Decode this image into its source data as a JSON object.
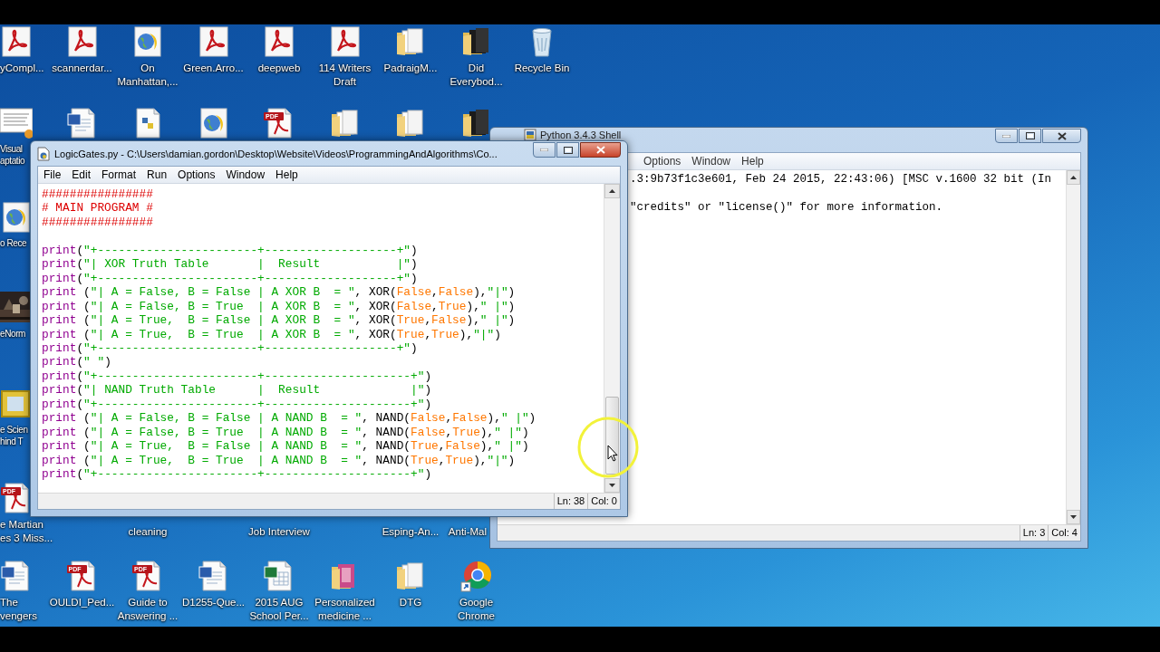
{
  "desktop_icons": [
    {
      "kind": "pdf",
      "lines": [
        "yCompl..."
      ]
    },
    {
      "kind": "pdf",
      "lines": [
        "scannerdar..."
      ]
    },
    {
      "kind": "globe",
      "lines": [
        "On",
        "Manhattan,..."
      ]
    },
    {
      "kind": "pdf",
      "lines": [
        "Green.Arro..."
      ]
    },
    {
      "kind": "pdf",
      "lines": [
        "deepweb"
      ]
    },
    {
      "kind": "pdf",
      "lines": [
        "114 Writers",
        "Draft"
      ]
    },
    {
      "kind": "folder",
      "lines": [
        "PadraigM..."
      ]
    },
    {
      "kind": "folder-dark",
      "lines": [
        "Did",
        "Everybod..."
      ]
    },
    {
      "kind": "recycle",
      "lines": [
        "Recycle Bin"
      ]
    },
    {
      "kind": "document",
      "lines": [
        "Visual",
        "aptatio"
      ]
    },
    {
      "kind": "word"
    },
    {
      "kind": "python"
    },
    {
      "kind": "globe"
    },
    {
      "kind": "pdf-badge",
      "badge": "PDF"
    },
    {
      "kind": "folder"
    },
    {
      "kind": "folder"
    },
    {
      "kind": "folder-dark"
    },
    {
      "kind": "globe",
      "lines": [
        "o Rece"
      ]
    },
    {
      "kind": "video",
      "lines": [
        "eNorm"
      ]
    },
    {
      "kind": "frame",
      "lines": [
        "e Scien",
        "hind T"
      ]
    },
    {
      "kind": "pdf-badge",
      "badge": "PDF",
      "lines": [
        "e Martian",
        "es 3 Miss..."
      ]
    },
    {
      "kind": "covered",
      "lines": [
        "cleaning"
      ]
    },
    {
      "kind": "covered",
      "lines": [
        "Job Interview"
      ]
    },
    {
      "kind": "covered",
      "lines": [
        "Esping-An..."
      ]
    },
    {
      "kind": "covered",
      "lines": [
        "Anti-Mal"
      ]
    },
    {
      "kind": "word",
      "lines": [
        "The",
        "vengers"
      ]
    },
    {
      "kind": "pdf-badge",
      "badge": "PDF",
      "lines": [
        "OULDI_Ped..."
      ]
    },
    {
      "kind": "pdf-badge",
      "badge": "PDF",
      "lines": [
        "Guide to",
        "Answering ..."
      ]
    },
    {
      "kind": "word",
      "lines": [
        "D1255-Que..."
      ]
    },
    {
      "kind": "excel",
      "lines": [
        "2015 AUG",
        "School Per..."
      ]
    },
    {
      "kind": "folder-photos",
      "lines": [
        "Personalized",
        "medicine ..."
      ]
    },
    {
      "kind": "folder",
      "lines": [
        "DTG"
      ]
    },
    {
      "kind": "chrome",
      "lines": [
        "Google",
        "Chrome"
      ]
    }
  ],
  "shell": {
    "title": "Python 3.4.3 Shell",
    "menu": [
      "Options",
      "Window",
      "Help"
    ],
    "lines": [
      ".3:9b73f1c3e601, Feb 24 2015, 22:43:06) [MSC v.1600 32 bit (In",
      "\"credits\" or \"license()\" for more information."
    ],
    "status": [
      "Ln: 3",
      "Col: 4"
    ]
  },
  "editor": {
    "title": "LogicGates.py - C:\\Users\\damian.gordon\\Desktop\\Website\\Videos\\ProgrammingAndAlgorithms\\Co...",
    "menu": [
      "File",
      "Edit",
      "Format",
      "Run",
      "Options",
      "Window",
      "Help"
    ],
    "lines": [
      [
        {
          "kind": "comment",
          "text": "################"
        }
      ],
      [
        {
          "kind": "comment",
          "text": "# MAIN PROGRAM #"
        }
      ],
      [
        {
          "kind": "comment",
          "text": "################"
        }
      ],
      [
        {
          "kind": "blank"
        },
        {
          "kind": "builtin",
          "text": "print"
        },
        {
          "kind": "plain",
          "text": "("
        },
        {
          "kind": "string",
          "text": "\"+-----------------------+-------------------+\""
        },
        {
          "kind": "plain",
          "text": ")"
        }
      ],
      [
        {
          "kind": "builtin",
          "text": "print"
        },
        {
          "kind": "plain",
          "text": "("
        },
        {
          "kind": "string",
          "text": "\"| XOR Truth Table       |  Result           |\""
        },
        {
          "kind": "plain",
          "text": ")"
        }
      ],
      [
        {
          "kind": "builtin",
          "text": "print"
        },
        {
          "kind": "plain",
          "text": "("
        },
        {
          "kind": "string",
          "text": "\"+-----------------------+-------------------+\""
        },
        {
          "kind": "plain",
          "text": ")"
        }
      ],
      [
        {
          "kind": "builtin",
          "text": "print"
        },
        {
          "kind": "plain",
          "text": " ("
        },
        {
          "kind": "string",
          "text": "\"| A = False, B = False | A XOR B  = \""
        },
        {
          "kind": "plain",
          "text": ", XOR("
        },
        {
          "kind": "keyword",
          "text": "False"
        },
        {
          "kind": "plain",
          "text": ","
        },
        {
          "kind": "keyword",
          "text": "False"
        },
        {
          "kind": "plain",
          "text": "),"
        },
        {
          "kind": "string",
          "text": "\"|\""
        },
        {
          "kind": "plain",
          "text": ")"
        }
      ],
      [
        {
          "kind": "builtin",
          "text": "print"
        },
        {
          "kind": "plain",
          "text": " ("
        },
        {
          "kind": "string",
          "text": "\"| A = False, B = True  | A XOR B  = \""
        },
        {
          "kind": "plain",
          "text": ", XOR("
        },
        {
          "kind": "keyword",
          "text": "False"
        },
        {
          "kind": "plain",
          "text": ","
        },
        {
          "kind": "keyword",
          "text": "True"
        },
        {
          "kind": "plain",
          "text": "),"
        },
        {
          "kind": "string",
          "text": "\" |\""
        },
        {
          "kind": "plain",
          "text": ")"
        }
      ],
      [
        {
          "kind": "builtin",
          "text": "print"
        },
        {
          "kind": "plain",
          "text": " ("
        },
        {
          "kind": "string",
          "text": "\"| A = True,  B = False | A XOR B  = \""
        },
        {
          "kind": "plain",
          "text": ", XOR("
        },
        {
          "kind": "keyword",
          "text": "True"
        },
        {
          "kind": "plain",
          "text": ","
        },
        {
          "kind": "keyword",
          "text": "False"
        },
        {
          "kind": "plain",
          "text": "),"
        },
        {
          "kind": "string",
          "text": "\" |\""
        },
        {
          "kind": "plain",
          "text": ")"
        }
      ],
      [
        {
          "kind": "builtin",
          "text": "print"
        },
        {
          "kind": "plain",
          "text": " ("
        },
        {
          "kind": "string",
          "text": "\"| A = True,  B = True  | A XOR B  = \""
        },
        {
          "kind": "plain",
          "text": ", XOR("
        },
        {
          "kind": "keyword",
          "text": "True"
        },
        {
          "kind": "plain",
          "text": ","
        },
        {
          "kind": "keyword",
          "text": "True"
        },
        {
          "kind": "plain",
          "text": "),"
        },
        {
          "kind": "string",
          "text": "\"|\""
        },
        {
          "kind": "plain",
          "text": ")"
        }
      ],
      [
        {
          "kind": "builtin",
          "text": "print"
        },
        {
          "kind": "plain",
          "text": "("
        },
        {
          "kind": "string",
          "text": "\"+-----------------------+-------------------+\""
        },
        {
          "kind": "plain",
          "text": ")"
        }
      ],
      [
        {
          "kind": "builtin",
          "text": "print"
        },
        {
          "kind": "plain",
          "text": "("
        },
        {
          "kind": "string",
          "text": "\" \""
        },
        {
          "kind": "plain",
          "text": ")"
        }
      ],
      [
        {
          "kind": "builtin",
          "text": "print"
        },
        {
          "kind": "plain",
          "text": "("
        },
        {
          "kind": "string",
          "text": "\"+-----------------------+---------------------+\""
        },
        {
          "kind": "plain",
          "text": ")"
        }
      ],
      [
        {
          "kind": "builtin",
          "text": "print"
        },
        {
          "kind": "plain",
          "text": "("
        },
        {
          "kind": "string",
          "text": "\"| NAND Truth Table      |  Result             |\""
        },
        {
          "kind": "plain",
          "text": ")"
        }
      ],
      [
        {
          "kind": "builtin",
          "text": "print"
        },
        {
          "kind": "plain",
          "text": "("
        },
        {
          "kind": "string",
          "text": "\"+-----------------------+---------------------+\""
        },
        {
          "kind": "plain",
          "text": ")"
        }
      ],
      [
        {
          "kind": "builtin",
          "text": "print"
        },
        {
          "kind": "plain",
          "text": " ("
        },
        {
          "kind": "string",
          "text": "\"| A = False, B = False | A NAND B  = \""
        },
        {
          "kind": "plain",
          "text": ", NAND("
        },
        {
          "kind": "keyword",
          "text": "False"
        },
        {
          "kind": "plain",
          "text": ","
        },
        {
          "kind": "keyword",
          "text": "False"
        },
        {
          "kind": "plain",
          "text": "),"
        },
        {
          "kind": "string",
          "text": "\" |\""
        },
        {
          "kind": "plain",
          "text": ")"
        }
      ],
      [
        {
          "kind": "builtin",
          "text": "print"
        },
        {
          "kind": "plain",
          "text": " ("
        },
        {
          "kind": "string",
          "text": "\"| A = False, B = True  | A NAND B  = \""
        },
        {
          "kind": "plain",
          "text": ", NAND("
        },
        {
          "kind": "keyword",
          "text": "False"
        },
        {
          "kind": "plain",
          "text": ","
        },
        {
          "kind": "keyword",
          "text": "True"
        },
        {
          "kind": "plain",
          "text": "),"
        },
        {
          "kind": "string",
          "text": "\" |\""
        },
        {
          "kind": "plain",
          "text": ")"
        }
      ],
      [
        {
          "kind": "builtin",
          "text": "print"
        },
        {
          "kind": "plain",
          "text": " ("
        },
        {
          "kind": "string",
          "text": "\"| A = True,  B = False | A NAND B  = \""
        },
        {
          "kind": "plain",
          "text": ", NAND("
        },
        {
          "kind": "keyword",
          "text": "True"
        },
        {
          "kind": "plain",
          "text": ","
        },
        {
          "kind": "keyword",
          "text": "False"
        },
        {
          "kind": "plain",
          "text": "),"
        },
        {
          "kind": "string",
          "text": "\" |\""
        },
        {
          "kind": "plain",
          "text": ")"
        }
      ],
      [
        {
          "kind": "builtin",
          "text": "print"
        },
        {
          "kind": "plain",
          "text": " ("
        },
        {
          "kind": "string",
          "text": "\"| A = True,  B = True  | A NAND B  = \""
        },
        {
          "kind": "plain",
          "text": ", NAND("
        },
        {
          "kind": "keyword",
          "text": "True"
        },
        {
          "kind": "plain",
          "text": ","
        },
        {
          "kind": "keyword",
          "text": "True"
        },
        {
          "kind": "plain",
          "text": "),"
        },
        {
          "kind": "string",
          "text": "\"|\""
        },
        {
          "kind": "plain",
          "text": ")"
        }
      ],
      [
        {
          "kind": "builtin",
          "text": "print"
        },
        {
          "kind": "plain",
          "text": "("
        },
        {
          "kind": "string",
          "text": "\"+-----------------------+---------------------+\""
        },
        {
          "kind": "plain",
          "text": ")"
        }
      ]
    ],
    "status": [
      "Ln: 38",
      "Col: 0"
    ]
  }
}
